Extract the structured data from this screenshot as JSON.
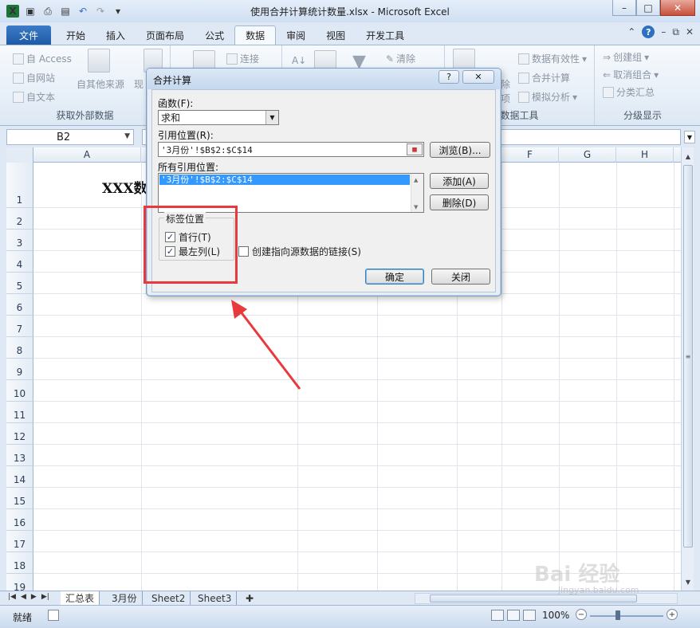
{
  "window": {
    "title": "使用合并计算统计数量.xlsx  -  Microsoft Excel",
    "min": "–",
    "max": "□",
    "close": "✕"
  },
  "tabs": [
    "文件",
    "开始",
    "插入",
    "页面布局",
    "公式",
    "数据",
    "审阅",
    "视图",
    "开发工具"
  ],
  "active_tab": "数据",
  "ribbon": {
    "get_external": {
      "access": "自 Access",
      "web": "自网站",
      "text": "自文本",
      "other": "自其他来源",
      "existing": "现",
      "label": "获取外部数据"
    },
    "connections": {
      "connect": "连接"
    },
    "sort": {
      "clear": "清除"
    },
    "data_tools": {
      "validation": "数据有效性",
      "consolidate": "合并计算",
      "whatif": "模拟分析",
      "partial1": "除",
      "partial2": "项",
      "label": "数据工具"
    },
    "outline": {
      "group": "创建组",
      "ungroup": "取消组合",
      "subtotal": "分类汇总",
      "label": "分级显示"
    }
  },
  "formula_bar": {
    "name_box": "B2",
    "formula": ""
  },
  "columns": [
    "A",
    "F",
    "G",
    "H"
  ],
  "rows": [
    "1",
    "2",
    "3",
    "4",
    "5",
    "6",
    "7",
    "8",
    "9",
    "10",
    "11",
    "12",
    "13",
    "14",
    "15",
    "16",
    "17",
    "18",
    "19"
  ],
  "cells": {
    "A1": "XXX数"
  },
  "dialog": {
    "title": "合并计算",
    "help": "?",
    "close": "✕",
    "function_label": "函数(F):",
    "function_value": "求和",
    "reference_label": "引用位置(R):",
    "reference_value": "'3月份'!$B$2:$C$14",
    "browse": "浏览(B)...",
    "all_refs_label": "所有引用位置:",
    "all_refs": [
      "'3月份'!$B$2:$C$14"
    ],
    "add": "添加(A)",
    "delete": "删除(D)",
    "label_position": "标签位置",
    "top_row": "首行(T)",
    "top_row_checked": true,
    "left_column": "最左列(L)",
    "left_column_checked": true,
    "create_links": "创建指向源数据的链接(S)",
    "create_links_checked": false,
    "ok": "确定",
    "close_btn": "关闭"
  },
  "sheet_tabs": [
    "汇总表",
    "3月份",
    "Sheet2",
    "Sheet3"
  ],
  "active_sheet": "汇总表",
  "status": {
    "ready": "就绪",
    "zoom": "100%"
  },
  "colors": {
    "annotation": "#e8393d",
    "selection": "#3399ff"
  },
  "watermark": {
    "logo": "Bai 经验",
    "url": "jingyan.baidu.com"
  }
}
